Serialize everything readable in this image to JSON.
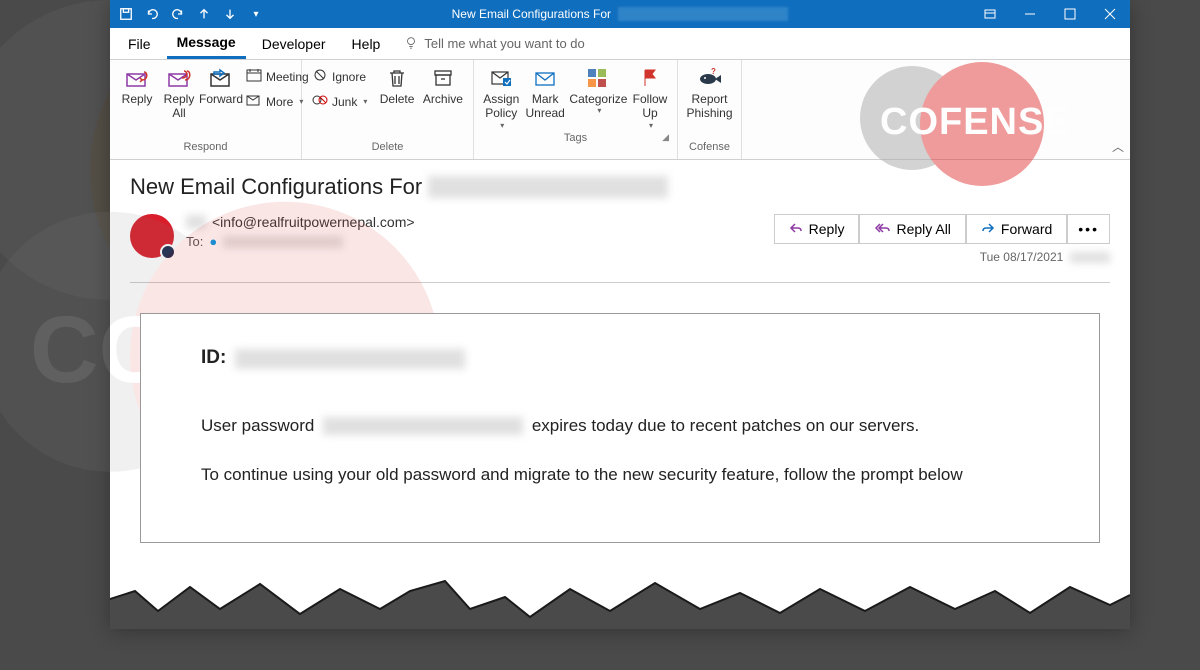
{
  "titlebar": {
    "title_prefix": "New Email Configurations For"
  },
  "tabs": {
    "file": "File",
    "message": "Message",
    "developer": "Developer",
    "help": "Help",
    "tellme": "Tell me what you want to do"
  },
  "ribbon": {
    "respond": {
      "label": "Respond",
      "reply": "Reply",
      "reply_all": "Reply\nAll",
      "forward": "Forward",
      "meeting": "Meeting",
      "more": "More"
    },
    "delete_group": {
      "label": "Delete",
      "ignore": "Ignore",
      "junk": "Junk",
      "delete": "Delete",
      "archive": "Archive"
    },
    "tags": {
      "label": "Tags",
      "assign_policy": "Assign\nPolicy",
      "mark_unread": "Mark\nUnread",
      "categorize": "Categorize",
      "follow_up": "Follow\nUp"
    },
    "cofense": {
      "label": "Cofense",
      "report": "Report\nPhishing"
    }
  },
  "watermark": {
    "brand": "COFENSE"
  },
  "message": {
    "subject_prefix": "New Email Configurations For",
    "from_email": "<info@realfruitpowernepal.com>",
    "to_label": "To:",
    "date": "Tue 08/17/2021",
    "actions": {
      "reply": "Reply",
      "reply_all": "Reply All",
      "forward": "Forward"
    },
    "body": {
      "id_label": "ID:",
      "p1a": "User password",
      "p1b": "expires today due to recent patches on our servers.",
      "p2": "To continue using your old password and migrate to the new security feature, follow the prompt below"
    }
  }
}
